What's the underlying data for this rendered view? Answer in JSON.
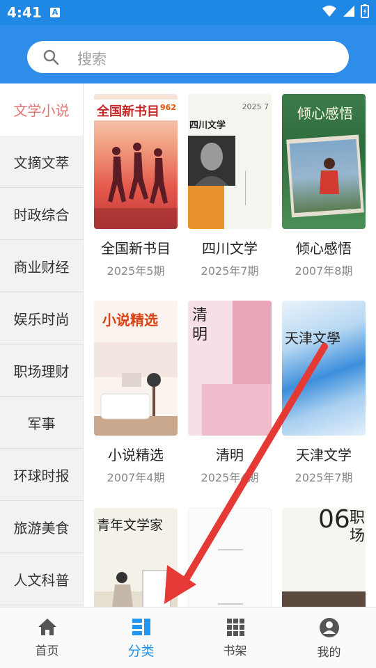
{
  "status": {
    "time": "4:41",
    "notification_letter": "A"
  },
  "search": {
    "placeholder": "搜索"
  },
  "sidebar": {
    "items": [
      {
        "label": "文学小说",
        "active": true
      },
      {
        "label": "文摘文萃"
      },
      {
        "label": "时政综合"
      },
      {
        "label": "商业财经"
      },
      {
        "label": "娱乐时尚"
      },
      {
        "label": "职场理财"
      },
      {
        "label": "军事"
      },
      {
        "label": "环球时报"
      },
      {
        "label": "旅游美食"
      },
      {
        "label": "人文科普"
      }
    ]
  },
  "books": [
    {
      "title": "全国新书目",
      "issue": "2025年5期",
      "cover_text": "全国新书目",
      "cover_number": "962"
    },
    {
      "title": "四川文学",
      "issue": "2025年7期",
      "cover_text": "四川文学",
      "cover_number": "2025 7"
    },
    {
      "title": "倾心感悟",
      "issue": "2007年8期",
      "cover_text": "倾心感悟"
    },
    {
      "title": "小说精选",
      "issue": "2007年4期",
      "cover_text": "小说精选"
    },
    {
      "title": "清明",
      "issue": "2025年4期",
      "cover_text": "清明"
    },
    {
      "title": "天津文学",
      "issue": "2025年7期",
      "cover_text": "天津文學"
    },
    {
      "title": "",
      "issue": "",
      "cover_text": "青年文学家"
    },
    {
      "title": "",
      "issue": "",
      "cover_text": ""
    },
    {
      "title": "",
      "issue": "",
      "cover_text": "职场",
      "cover_number": "06"
    }
  ],
  "bottom_nav": [
    {
      "label": "首页",
      "icon": "home-icon"
    },
    {
      "label": "分类",
      "icon": "category-icon",
      "active": true
    },
    {
      "label": "书架",
      "icon": "grid-icon"
    },
    {
      "label": "我的",
      "icon": "person-icon"
    }
  ],
  "colors": {
    "accent": "#2196f3",
    "header": "#2e8de8",
    "active_category": "#e57373",
    "arrow": "#e53935"
  }
}
